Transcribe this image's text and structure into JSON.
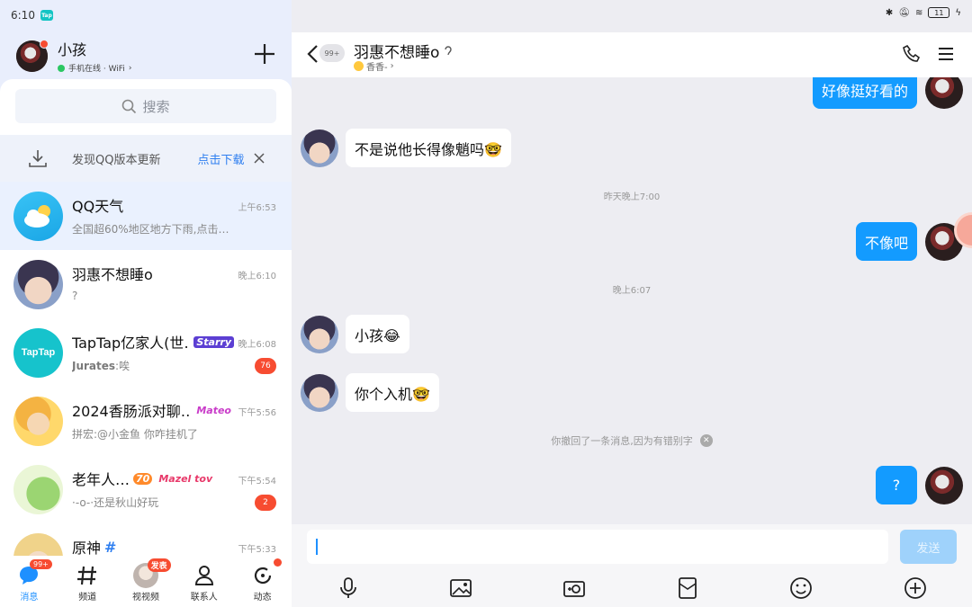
{
  "status_left": {
    "time": "6:10",
    "app_icon": "Tap"
  },
  "status_right": {
    "battery": "11"
  },
  "profile": {
    "name": "小孩",
    "status": "手机在线 · WiFi"
  },
  "search": {
    "placeholder": "搜索"
  },
  "update_bar": {
    "text": "发现QQ版本更新",
    "link": "点击下载"
  },
  "conversations": [
    {
      "title": "QQ天气",
      "message": "全国超60%地区地方下雨,点击查看…",
      "time": "上午6:53",
      "avatar": "weather-icon",
      "selected": true
    },
    {
      "title": "羽惠不想睡o",
      "message": "?",
      "time": "晚上6:10",
      "avatar": "boy-avatar"
    },
    {
      "title": "TapTap亿家人(世…",
      "tag": "Starry",
      "message_prefix": "Jurates",
      "message": ":唉",
      "time": "晚上6:08",
      "badge": "76",
      "avatar": "taptap-logo"
    },
    {
      "title": "2024香肠派对聊…",
      "tag": "Mateo",
      "message": "拼宏:@小金鱼 你咋挂机了",
      "time": "下午5:56",
      "avatar": "anime-avatar"
    },
    {
      "title": "老年人…",
      "tag": "Mazel tov",
      "level": "70",
      "message": "·-o-·还是秋山好玩",
      "time": "下午5:54",
      "badge": "2",
      "avatar": "frog-avatar"
    },
    {
      "title": "原神",
      "title_suffix": "#",
      "message": "",
      "time": "下午5:33",
      "avatar": "genshin-avatar"
    }
  ],
  "bottom_nav": [
    {
      "label": "消息",
      "icon": "message-icon",
      "badge": "99+",
      "active": true
    },
    {
      "label": "频道",
      "icon": "hash-icon"
    },
    {
      "label": "视视频",
      "icon": "video-avatar-icon",
      "badge": "发表"
    },
    {
      "label": "联系人",
      "icon": "contacts-icon"
    },
    {
      "label": "动态",
      "icon": "moments-icon",
      "dot": true
    }
  ],
  "chat": {
    "title": "羽惠不想睡o",
    "subtitle": "香香-",
    "unread": "99+",
    "messages": [
      {
        "side": "out",
        "text": "好像挺好看的"
      },
      {
        "side": "in",
        "text": "不是说他长得像魈吗🤓"
      },
      {
        "type": "time",
        "text": "昨天晚上7:00"
      },
      {
        "side": "out",
        "text": "不像吧"
      },
      {
        "type": "time",
        "text": "晚上6:07"
      },
      {
        "side": "in",
        "text": "小孩😂"
      },
      {
        "side": "in",
        "text": "你个入机🤓"
      },
      {
        "type": "recall",
        "text": "你撤回了一条消息,因为有错别字"
      },
      {
        "side": "out",
        "text": "?"
      }
    ],
    "send_label": "发送"
  },
  "colors": {
    "accent": "#139bff",
    "badge": "#f74c31",
    "online": "#2bc763"
  }
}
